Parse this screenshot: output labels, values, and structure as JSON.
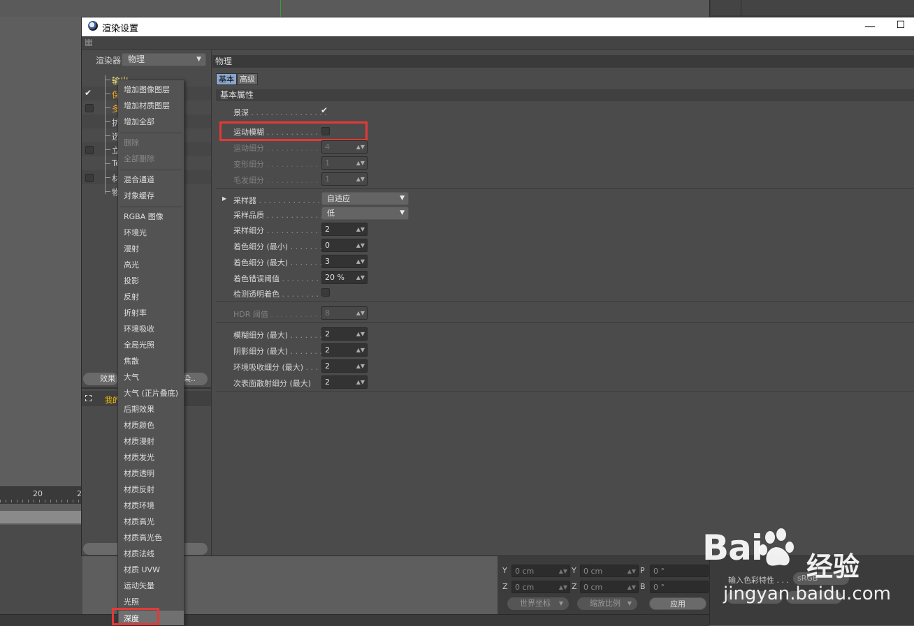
{
  "dialog": {
    "title": "渲染设置",
    "min_glyph": "—",
    "max_glyph": "☐"
  },
  "left_panel": {
    "renderer_label": "渲染器",
    "renderer_value": "物理",
    "tree_items": [
      {
        "label": "输出",
        "checked": null
      },
      {
        "label": "保",
        "checked": true
      },
      {
        "label": "多",
        "checked": false
      },
      {
        "label": "抗",
        "checked": null
      },
      {
        "label": "选",
        "checked": null
      },
      {
        "label": "立",
        "checked": false
      },
      {
        "label": "Te",
        "checked": null
      },
      {
        "label": "材",
        "checked": false
      },
      {
        "label": "物",
        "checked": null
      }
    ],
    "effect_button": "效果",
    "render_button": "染..",
    "my_settings": "我的"
  },
  "context_menu": {
    "items": [
      {
        "label": "增加图像图层",
        "disabled": false
      },
      {
        "label": "增加材质图层",
        "disabled": false
      },
      {
        "label": "增加全部",
        "disabled": false
      },
      {
        "label": "删除",
        "disabled": true
      },
      {
        "label": "全部删除",
        "disabled": true
      },
      {
        "label": "混合通道",
        "disabled": false
      },
      {
        "label": "对象缓存",
        "disabled": false
      },
      {
        "label": "RGBA 图像",
        "disabled": false
      },
      {
        "label": "环境光",
        "disabled": false
      },
      {
        "label": "漫射",
        "disabled": false
      },
      {
        "label": "高光",
        "disabled": false
      },
      {
        "label": "投影",
        "disabled": false
      },
      {
        "label": "反射",
        "disabled": false
      },
      {
        "label": "折射率",
        "disabled": false
      },
      {
        "label": "环境吸收",
        "disabled": false
      },
      {
        "label": "全局光照",
        "disabled": false
      },
      {
        "label": "焦散",
        "disabled": false
      },
      {
        "label": "大气",
        "disabled": false
      },
      {
        "label": "大气 (正片叠底)",
        "disabled": false
      },
      {
        "label": "后期效果",
        "disabled": false
      },
      {
        "label": "材质颜色",
        "disabled": false
      },
      {
        "label": "材质漫射",
        "disabled": false
      },
      {
        "label": "材质发光",
        "disabled": false
      },
      {
        "label": "材质透明",
        "disabled": false
      },
      {
        "label": "材质反射",
        "disabled": false
      },
      {
        "label": "材质环境",
        "disabled": false
      },
      {
        "label": "材质高光",
        "disabled": false
      },
      {
        "label": "材质高光色",
        "disabled": false
      },
      {
        "label": "材质法线",
        "disabled": false
      },
      {
        "label": "材质 UVW",
        "disabled": false
      },
      {
        "label": "运动矢量",
        "disabled": false
      },
      {
        "label": "光照",
        "disabled": false
      }
    ],
    "highlighted_item": "深度"
  },
  "right_panel": {
    "header": "物理",
    "tabs": [
      "基本",
      "高级"
    ],
    "active_tab": "基本",
    "section_title": "基本属性",
    "properties": {
      "dof": {
        "label": "景深",
        "dots": " . . . . . . . . . . . . . . . .",
        "checked": true
      },
      "motion_blur": {
        "label": "运动模糊",
        "dots": " . . . . . . . . . . . . .",
        "checked": false
      },
      "motion_subdiv": {
        "label": "运动细分",
        "dots": " . . . . . . . . . . . . .",
        "value": "4"
      },
      "deform_subdiv": {
        "label": "变形细分",
        "dots": " . . . . . . . . . . . . .",
        "value": "1"
      },
      "hair_subdiv": {
        "label": "毛发细分",
        "dots": " . . . . . . . . . . . . .",
        "value": "1"
      },
      "sampler": {
        "label": "采样器",
        "dots": " . . . . . . . . . . . . . . . .",
        "value": "自适应"
      },
      "sample_quality": {
        "label": "采样品质",
        "dots": " . . . . . . . . . . . . . .",
        "value": "低"
      },
      "sample_subdiv": {
        "label": "采样细分",
        "dots": " . . . . . . . . . . . . . .",
        "value": "2"
      },
      "shading_min": {
        "label": "着色细分 (最小)",
        "dots": " . . . . . . .",
        "value": "0"
      },
      "shading_max": {
        "label": "着色细分 (最大)",
        "dots": " . . . . . . .",
        "value": "3"
      },
      "shading_error": {
        "label": "着色错误阈值",
        "dots": " . . . . . . . . .",
        "value": "20 %"
      },
      "detect_transp": {
        "label": "检测透明着色",
        "dots": " . . . . . . . . .",
        "checked": false
      },
      "hdr_threshold": {
        "label": "HDR 阈值",
        "dots": " . . . . . . . . . . . .",
        "value": "8"
      },
      "blur_subdiv": {
        "label": "模糊细分 (最大)",
        "dots": " . . . . . . .",
        "value": "2"
      },
      "shadow_subdiv": {
        "label": "阴影细分 (最大)",
        "dots": " . . . . . . .",
        "value": "2"
      },
      "ao_subdiv": {
        "label": "环境吸收细分 (最大)",
        "dots": " . . . .",
        "value": "2"
      },
      "sss_subdiv": {
        "label": "次表面散射细分 (最大)",
        "dots": "",
        "value": "2"
      }
    }
  },
  "background": {
    "timeline_labels": [
      "20",
      "2"
    ],
    "coords": {
      "y_label": "Y",
      "y_value": "0 cm",
      "y2_label": "Y",
      "y2_value": "0 cm",
      "p_label": "P",
      "p_value": "0 °",
      "z_label": "Z",
      "z_value": "0 cm",
      "z2_label": "Z",
      "z2_value": "0 cm",
      "b_label": "B",
      "b_value": "0 °",
      "world_coords": "世界坐标",
      "scale": "缩放比例",
      "apply": "应用"
    },
    "right_lower": {
      "text1": "输入色彩特性 . . .",
      "value1": "sRGB"
    }
  },
  "watermark": {
    "logo": "Bai",
    "logo2": "经验",
    "url": "jingyan.baidu.com"
  },
  "colors": {
    "highlight_box": "#e53935",
    "active_tab": "#8aa7cc",
    "orange_text": "#f5a623"
  }
}
